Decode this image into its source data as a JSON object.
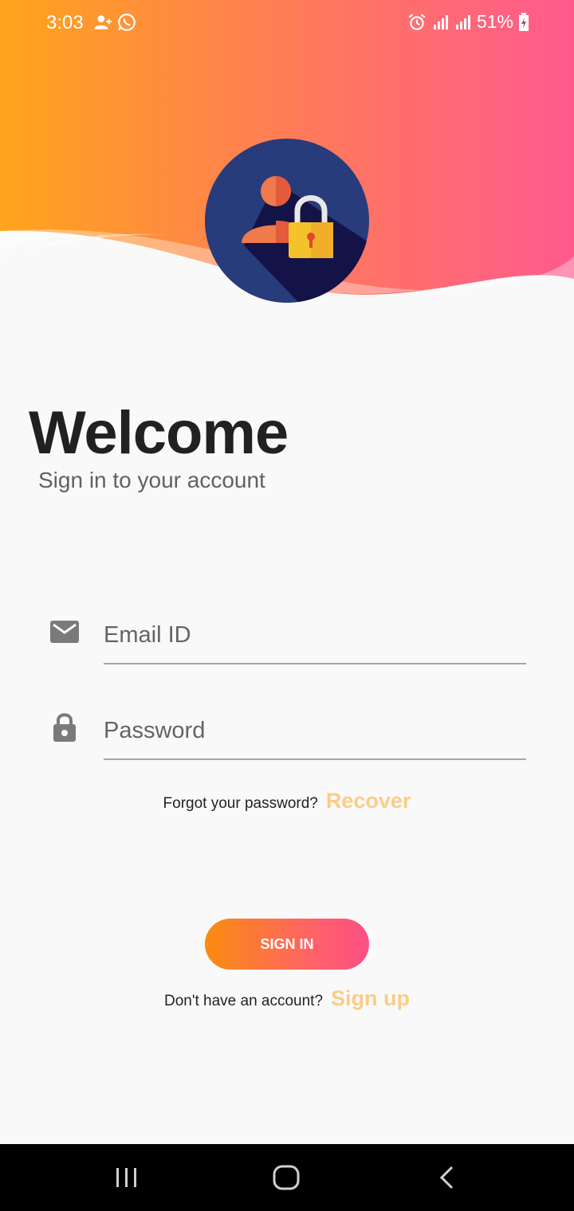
{
  "status_bar": {
    "time": "3:03",
    "battery": "51%",
    "icons": [
      "person-add-icon",
      "whatsapp-icon",
      "alarm-icon",
      "signal-icon",
      "signal-icon",
      "battery-charging-icon"
    ]
  },
  "header": {
    "gradient_colors": [
      "#ffa41b",
      "#ff7c57",
      "#ff5a8e"
    ],
    "logo_icon": "user-lock-icon"
  },
  "welcome": {
    "title": "Welcome",
    "subtitle": "Sign in to your account"
  },
  "form": {
    "email": {
      "placeholder": "Email ID",
      "value": "",
      "icon": "mail-icon"
    },
    "password": {
      "placeholder": "Password",
      "value": "",
      "icon": "lock-icon"
    },
    "forgot_text": "Forgot your password?",
    "recover_label": "Recover",
    "signin_label": "SIGN IN",
    "no_account_text": "Don't have an account?",
    "signup_label": "Sign up"
  },
  "colors": {
    "accent_link": "#fccc86",
    "button_gradient": [
      "#fb8c0f",
      "#fb4f84"
    ]
  },
  "nav_bar": {
    "items": [
      "recent-apps-icon",
      "home-icon",
      "back-icon"
    ]
  }
}
